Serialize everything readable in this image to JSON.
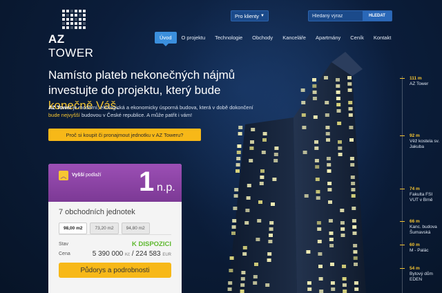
{
  "logo": {
    "name_a": "AZ",
    "name_b": "TOWER"
  },
  "header": {
    "client_select": "Pro klienty",
    "search_placeholder": "Hledaný výraz",
    "search_button": "HLEDAT"
  },
  "nav": [
    {
      "label": "Úvod",
      "active": true
    },
    {
      "label": "O projektu"
    },
    {
      "label": "Technologie"
    },
    {
      "label": "Obchody"
    },
    {
      "label": "Kanceláře"
    },
    {
      "label": "Apartmány"
    },
    {
      "label": "Ceník"
    },
    {
      "label": "Kontakt"
    }
  ],
  "hero": {
    "headline_a": "Namísto plateb nekonečných nájmů investujte do projektu, který bude ",
    "headline_hl": "konečně Váš",
    "headline_b": ".",
    "lead_b": "AZ Tower",
    "lead_a": " je moderní, ekologická a ekonomicky úsporná budova, která v době dokončení ",
    "lead_hl": "bude nejvyšší",
    "lead_c": " budovou v České republice. A může patřit i vám!",
    "cta": "Proč si koupit či pronajmout jednotku v AZ Toweru?"
  },
  "card": {
    "floor_label_b": "Vyšší",
    "floor_label": " podlaží",
    "floor_number": "1",
    "floor_suffix": "n.p.",
    "units": "7 obchodních jednotek",
    "tabs": [
      "98,00 m2",
      "73,20 m2",
      "94,80 m2"
    ],
    "status_label": "Stav",
    "status_value": "K DISPOZICI",
    "price_label": "Cena",
    "price_czk": "5 390 000",
    "price_czk_unit": "Kč",
    "price_eur": "224 583",
    "price_eur_unit": "EUR",
    "button": "Půdorys a podrobnosti"
  },
  "height_scale": [
    {
      "h": "111 m",
      "name": "AZ Tower"
    },
    {
      "h": "92 m",
      "name": "Věž kostela sv. Jakuba"
    },
    {
      "h": "74 m",
      "name": "Fakulta FSI VUT v Brně"
    },
    {
      "h": "66 m",
      "name": "Kanc. budova Šumavská"
    },
    {
      "h": "60 m",
      "name": "M - Palác"
    },
    {
      "h": "54 m",
      "name": "Bytový dům EDEN"
    }
  ],
  "colors": {
    "accent": "#f7b818",
    "nav_active": "#3b8fdd",
    "card_header": "#8a44a5",
    "available": "#5db82e"
  }
}
